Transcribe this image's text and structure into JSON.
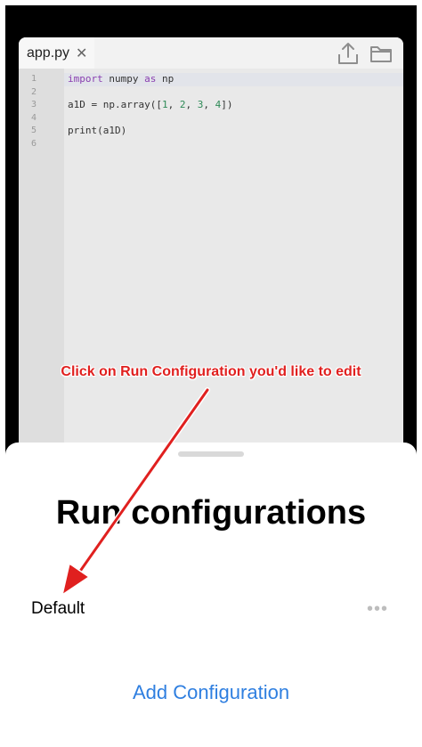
{
  "editor": {
    "tab": {
      "name": "app.py",
      "close": "✕"
    },
    "icons": [
      "share-icon",
      "folder-icon"
    ],
    "line_numbers": [
      "1",
      "2",
      "3",
      "4",
      "5",
      "6"
    ],
    "code_lines": [
      [
        {
          "t": "kw",
          "v": "import"
        },
        {
          "t": "",
          "v": " numpy "
        },
        {
          "t": "kw",
          "v": "as"
        },
        {
          "t": "",
          "v": " np"
        }
      ],
      [],
      [
        {
          "t": "",
          "v": "a1D = np.array(["
        },
        {
          "t": "num",
          "v": "1"
        },
        {
          "t": "",
          "v": ", "
        },
        {
          "t": "num",
          "v": "2"
        },
        {
          "t": "",
          "v": ", "
        },
        {
          "t": "num",
          "v": "3"
        },
        {
          "t": "",
          "v": ", "
        },
        {
          "t": "num",
          "v": "4"
        },
        {
          "t": "",
          "v": "])"
        }
      ],
      [],
      [
        {
          "t": "",
          "v": "print(a1D)"
        }
      ],
      []
    ]
  },
  "annotation": {
    "text": "Click on Run Configuration you'd like to edit",
    "color": "#e0201f"
  },
  "sheet": {
    "title": "Run configurations",
    "configs": [
      {
        "name": "Default",
        "more": "•••"
      }
    ],
    "add_label": "Add Configuration",
    "accent": "#2f7fe0"
  }
}
